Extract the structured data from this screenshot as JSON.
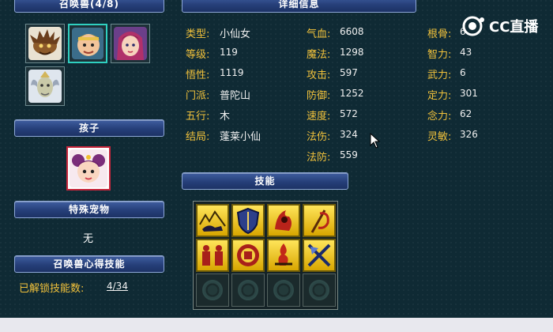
{
  "panels": {
    "summon_title": "召唤兽(4/8)",
    "details_title": "详细信息",
    "child_title": "孩子",
    "special_pet_title": "特殊宠物",
    "special_pet_value": "无",
    "insight_title": "召唤兽心得技能",
    "skills_title": "技能"
  },
  "summons": [
    {
      "icon": "spiky-beast-avatar"
    },
    {
      "icon": "monkey-king-avatar",
      "selected": true
    },
    {
      "icon": "fairy-girl-avatar"
    },
    {
      "icon": "white-dragon-avatar"
    }
  ],
  "child": {
    "icon": "child-avatar"
  },
  "unlock": {
    "label": "已解锁技能数:",
    "value": "4/34"
  },
  "stats": {
    "col1": [
      {
        "label": "类型:",
        "value": "小仙女"
      },
      {
        "label": "等级:",
        "value": "119"
      },
      {
        "label": "悟性:",
        "value": "1119"
      },
      {
        "label": "门派:",
        "value": "普陀山"
      },
      {
        "label": "五行:",
        "value": "木"
      },
      {
        "label": "结局:",
        "value": "蓬莱小仙"
      }
    ],
    "col2": [
      {
        "label": "气血:",
        "value": "6608"
      },
      {
        "label": "魔法:",
        "value": "1298"
      },
      {
        "label": "攻击:",
        "value": "597"
      },
      {
        "label": "防御:",
        "value": "1252"
      },
      {
        "label": "速度:",
        "value": "572"
      },
      {
        "label": "法伤:",
        "value": "324"
      },
      {
        "label": "法防:",
        "value": "559"
      }
    ],
    "col3": [
      {
        "label": "根骨:",
        "value": "6"
      },
      {
        "label": "智力:",
        "value": "43"
      },
      {
        "label": "武力:",
        "value": "6"
      },
      {
        "label": "定力:",
        "value": "301"
      },
      {
        "label": "念力:",
        "value": "62"
      },
      {
        "label": "灵敏:",
        "value": "326"
      }
    ]
  },
  "skills": [
    {
      "icon": "wolf-mountain-skill-icon"
    },
    {
      "icon": "shield-skill-icon"
    },
    {
      "icon": "flame-warrior-skill-icon"
    },
    {
      "icon": "staff-strike-skill-icon"
    },
    {
      "icon": "demon-pair-skill-icon"
    },
    {
      "icon": "round-seal-skill-icon"
    },
    {
      "icon": "fire-sword-skill-icon"
    },
    {
      "icon": "crossed-blades-skill-icon"
    }
  ],
  "watermark": {
    "text": "CC直播"
  },
  "colors": {
    "label": "#f2c23b",
    "header": "#263f79",
    "background": "#0f2a34",
    "skill": "#f0c520"
  }
}
